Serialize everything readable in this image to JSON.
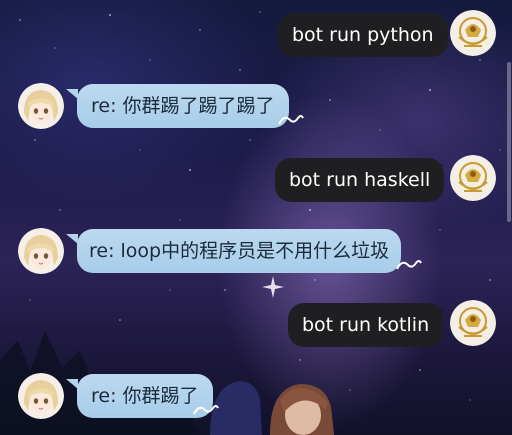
{
  "messages": [
    {
      "direction": "outgoing",
      "text": "bot run python",
      "avatar": "emblem-avatar"
    },
    {
      "direction": "incoming",
      "text": "re: 你群踢了踢了踢了",
      "avatar": "anime-girl-avatar"
    },
    {
      "direction": "outgoing",
      "text": "bot run haskell",
      "avatar": "emblem-avatar"
    },
    {
      "direction": "incoming",
      "text": "re: loop中的程序员是不用什么垃圾",
      "avatar": "anime-girl-avatar"
    },
    {
      "direction": "outgoing",
      "text": "bot run kotlin",
      "avatar": "emblem-avatar"
    },
    {
      "direction": "incoming",
      "text": "re: 你群踢了",
      "avatar": "anime-girl-avatar"
    }
  ],
  "colors": {
    "outgoing_bubble": "#1f1f22",
    "incoming_bubble": "#a8cde9",
    "emblem_gold": "#c99a2e"
  }
}
